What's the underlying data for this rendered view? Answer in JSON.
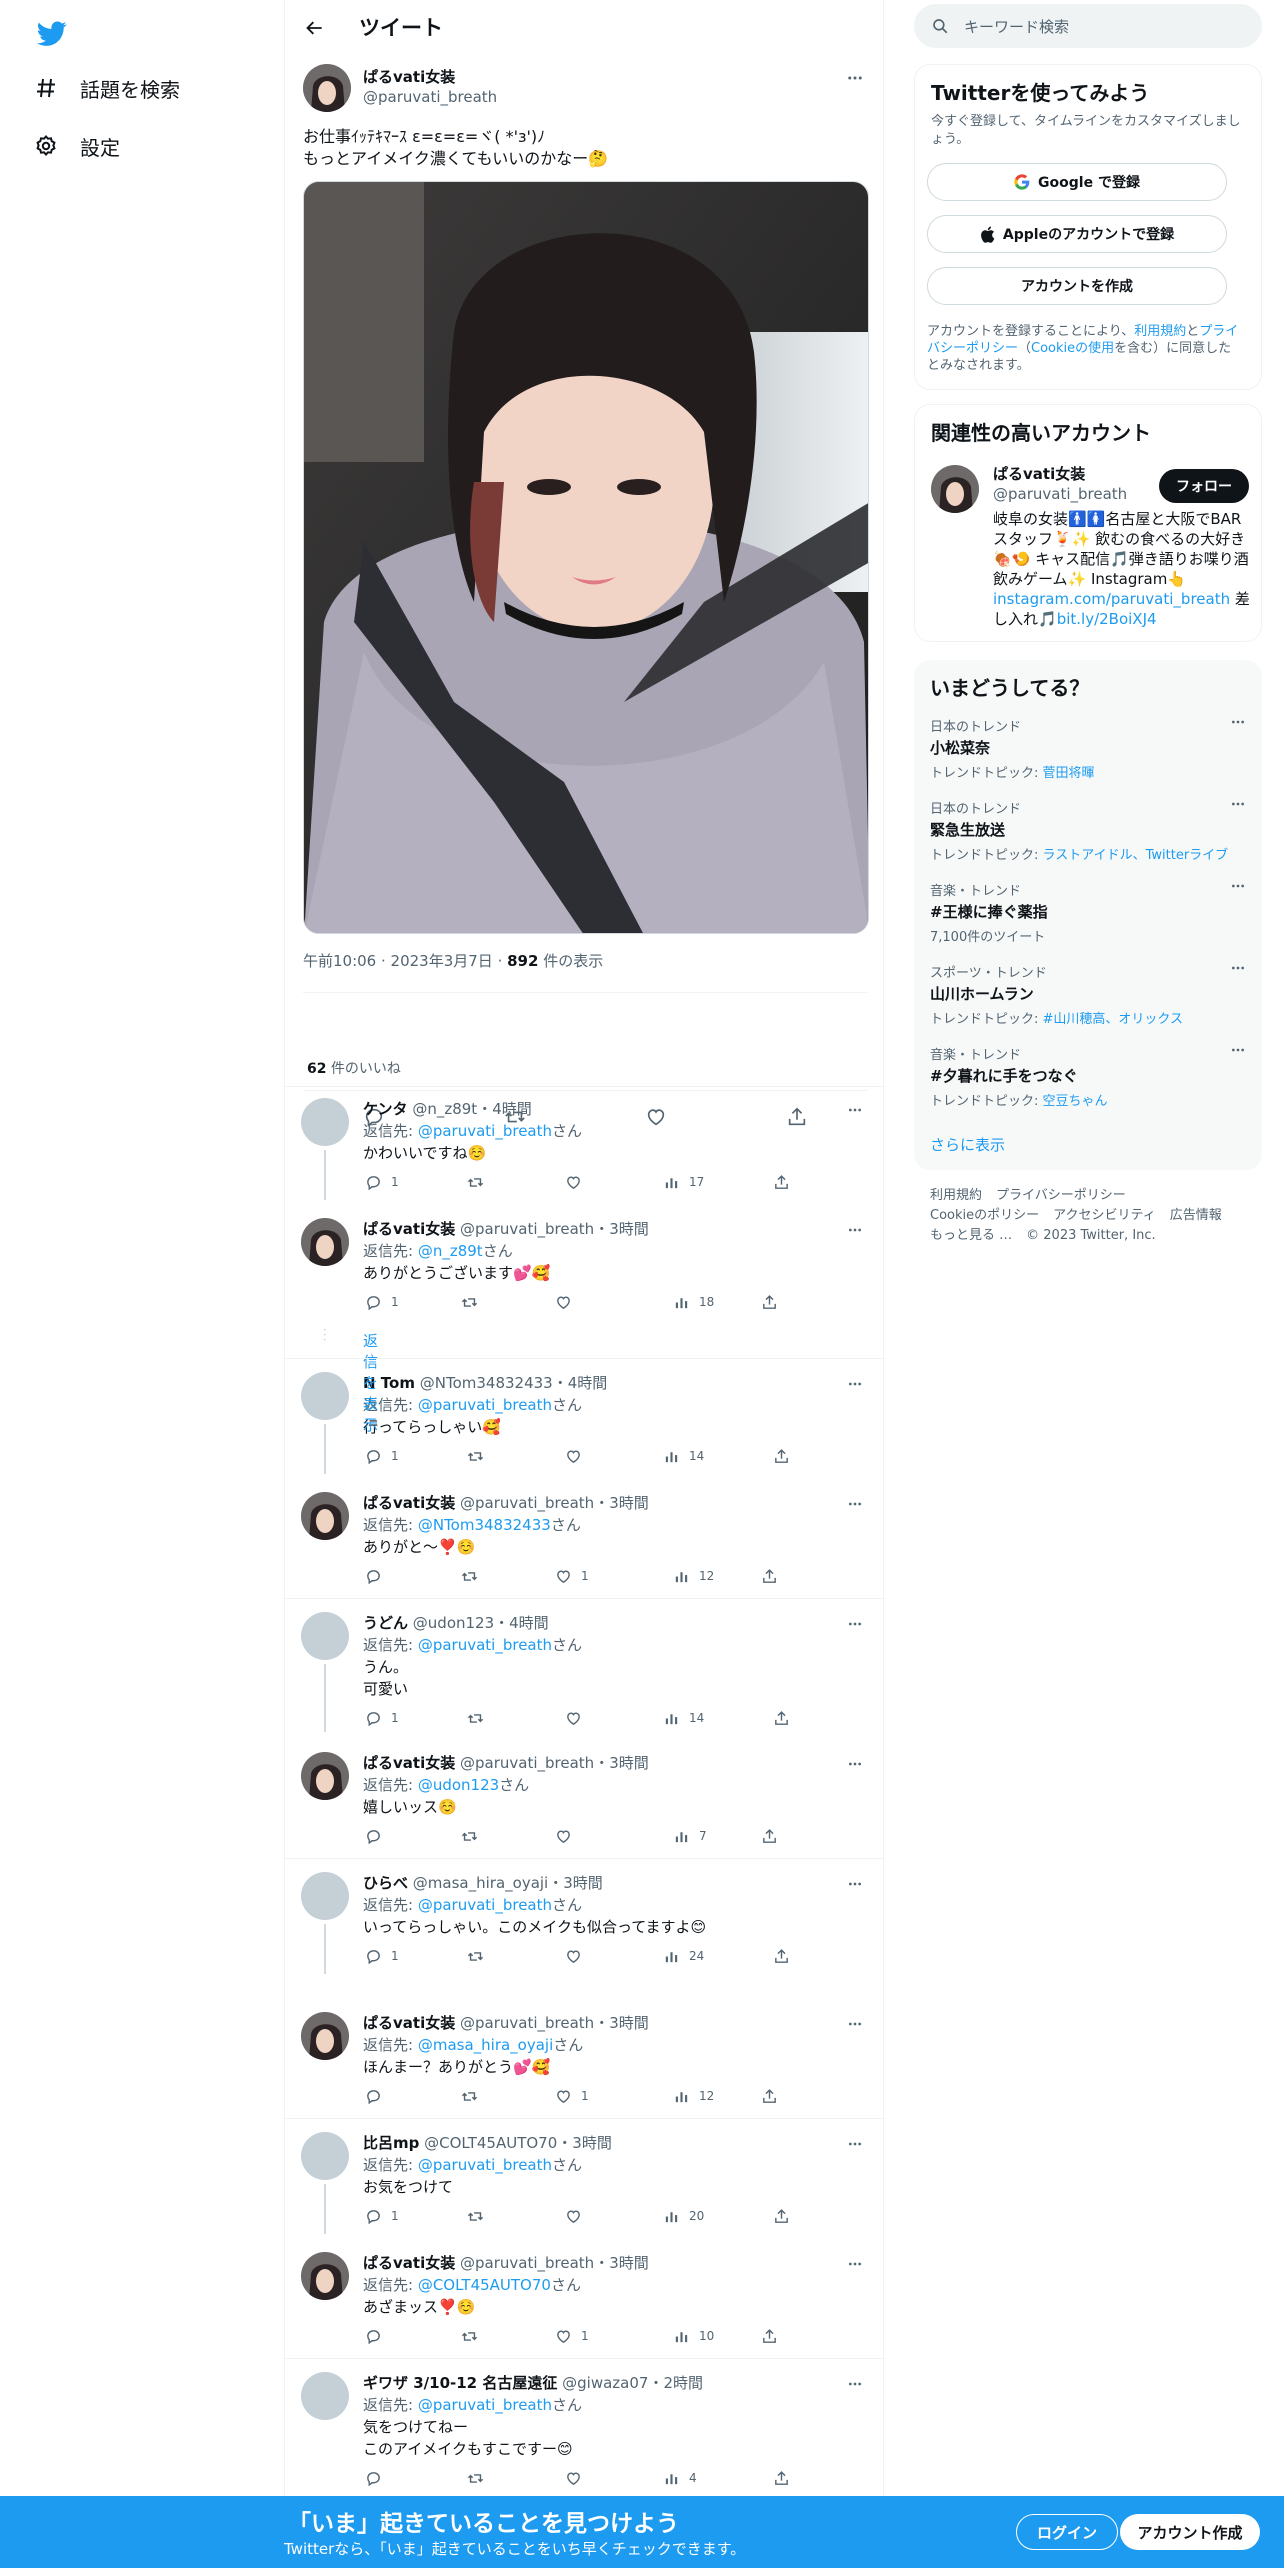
{
  "nav": {
    "explore_label": "話題を検索",
    "settings_label": "設定"
  },
  "header": {
    "title": "ツイート"
  },
  "main_tweet": {
    "author_name": "ぱるvati女装",
    "author_handle": "@paruvati_breath",
    "text": "お仕事ｲｯﾃｷﾏｰｽ ε=ε=ε=ヾ( *'з')ﾉ\nもっとアイメイク濃くてもいいのかなー🤔",
    "time": "午前10:06",
    "date": "2023年3月7日",
    "views_count": "892",
    "views_label": " 件の表示",
    "likes_count": "62",
    "likes_label": " 件のいいね"
  },
  "reply_prefix": "返信先: ",
  "reply_suffix": "さん",
  "show_replies": "返信を表示",
  "replies": [
    {
      "name": "ケンタ",
      "handle": "@n_z89t",
      "time": "・4時間",
      "to": "@paruvati_breath",
      "text": "かわいいですね☺️",
      "reply": "1",
      "views": "17"
    },
    {
      "name": "ぱるvati女装",
      "handle": "@paruvati_breath",
      "time": "・3時間",
      "to": "@n_z89t",
      "text": "ありがとうございます💕🥰",
      "reply": "1",
      "views": "18"
    },
    {
      "name": "N Tom",
      "handle": "@NTom34832433",
      "time": "・4時間",
      "to": "@paruvati_breath",
      "text": "行ってらっしゃい🥰",
      "reply": "1",
      "views": "14"
    },
    {
      "name": "ぱるvati女装",
      "handle": "@paruvati_breath",
      "time": "・3時間",
      "to": "@NTom34832433",
      "text": "ありがと〜❣️☺️",
      "like": "1",
      "views": "12"
    },
    {
      "name": "うどん",
      "handle": "@udon123",
      "time": "・4時間",
      "to": "@paruvati_breath",
      "text": "うん。\n可愛い",
      "reply": "1",
      "views": "14"
    },
    {
      "name": "ぱるvati女装",
      "handle": "@paruvati_breath",
      "time": "・3時間",
      "to": "@udon123",
      "text": "嬉しいッス☺️",
      "views": "7"
    },
    {
      "name": "ひらべ",
      "handle": "@masa_hira_oyaji",
      "time": "・3時間",
      "to": "@paruvati_breath",
      "text": "いってらっしゃい。このメイクも似合ってますよ😊",
      "reply": "1",
      "views": "24"
    },
    {
      "name": "ぱるvati女装",
      "handle": "@paruvati_breath",
      "time": "・3時間",
      "to": "@masa_hira_oyaji",
      "text": "ほんまー？ありがとう💕🥰",
      "like": "1",
      "views": "12"
    },
    {
      "name": "比呂mp",
      "handle": "@COLT45AUTO70",
      "time": "・3時間",
      "to": "@paruvati_breath",
      "text": "お気をつけて",
      "reply": "1",
      "views": "20"
    },
    {
      "name": "ぱるvati女装",
      "handle": "@paruvati_breath",
      "time": "・3時間",
      "to": "@COLT45AUTO70",
      "text": "あざまッス❣️☺️",
      "like": "1",
      "views": "10"
    },
    {
      "name": "ギワザ 3/10-12 名古屋遠征",
      "handle": "@giwaza07",
      "time": "・2時間",
      "to": "@paruvati_breath",
      "text": "気をつけてねー\nこのアイメイクもすこですー😊",
      "views": "4"
    }
  ],
  "search": {
    "placeholder": "キーワード検索"
  },
  "signup": {
    "title": "Twitterを使ってみよう",
    "subtitle": "今すぐ登録して、タイムラインをカスタマイズしましょう。",
    "google_btn": "Google で登録",
    "apple_btn": "Appleのアカウントで登録",
    "create_btn": "アカウントを作成",
    "legal_1": "アカウントを登録することにより、",
    "legal_terms": "利用規約",
    "legal_2": "と",
    "legal_privacy": "プライバシーポリシー",
    "legal_3": "（",
    "legal_cookie": "Cookieの使用",
    "legal_4": "を含む）に同意したとみなされます。"
  },
  "related": {
    "title": "関連性の高いアカウント",
    "name": "ぱるvati女装",
    "handle": "@paruvati_breath",
    "follow": "フォロー",
    "bio_1": "岐阜の女装🚹🚺名古屋と大阪でBARスタッフ🍹✨ 飲むの食べるの大好き🍖🍤 キャス配信🎵弾き語りお喋り酒飲みゲーム✨ Instagram👆",
    "bio_link1": "instagram.com/paruvati_breath",
    "bio_2": " 差し入れ🎵",
    "bio_link2": "bit.ly/2BoiXJ4"
  },
  "trends": {
    "title": "いまどうしてる？",
    "topic_prefix": "トレンドトピック: ",
    "items": [
      {
        "category": "日本のトレンド",
        "name": "小松菜奈",
        "sub_links": "菅田将暉"
      },
      {
        "category": "日本のトレンド",
        "name": "緊急生放送",
        "sub_links": "ラストアイドル、Twitterライブ"
      },
      {
        "category": "音楽・トレンド",
        "name": "#王様に捧ぐ薬指",
        "sub_plain": "7,100件のツイート"
      },
      {
        "category": "スポーツ・トレンド",
        "name": "山川ホームラン",
        "sub_links": "#山川穂高、オリックス"
      },
      {
        "category": "音楽・トレンド",
        "name": "#夕暮れに手をつなぐ",
        "sub_links": "空豆ちゃん"
      }
    ],
    "show_more": "さらに表示"
  },
  "footer": {
    "terms": "利用規約",
    "privacy": "プライバシーポリシー",
    "cookie": "Cookieのポリシー",
    "accessibility": "アクセシビリティ",
    "ads": "広告情報",
    "more": "もっと見る …",
    "copyright": "© 2023 Twitter, Inc."
  },
  "bottom_bar": {
    "title": "「いま」起きていることを見つけよう",
    "subtitle": "Twitterなら、「いま」起きていることをいち早くチェックできます。",
    "login": "ログイン",
    "signup": "アカウント作成"
  },
  "colors": {
    "accent": "#1d9bf0",
    "text": "#0f1419",
    "muted": "#536471",
    "border": "#eff3f4"
  },
  "icons": [
    "twitter-logo-icon",
    "hashtag-icon",
    "gear-icon",
    "back-arrow-icon",
    "more-icon",
    "reply-icon",
    "retweet-icon",
    "like-icon",
    "views-icon",
    "share-icon",
    "search-icon",
    "google-icon",
    "apple-icon"
  ]
}
